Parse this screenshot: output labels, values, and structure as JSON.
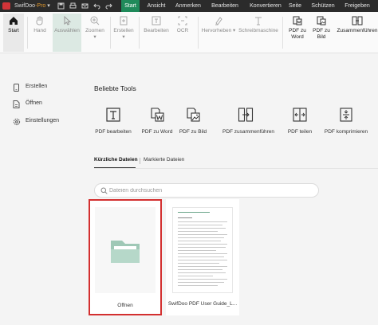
{
  "app": {
    "brand_name": "SwifDoo",
    "brand_suffix": "-Pro",
    "brand_arrow": "▾",
    "accent_color": "#1f8a5a",
    "highlight_color": "#d32f2f"
  },
  "menu": {
    "items": [
      "Start",
      "Ansicht",
      "Anmerken",
      "Bearbeiten",
      "Konvertieren",
      "Seite",
      "Schützen",
      "Freigeben"
    ],
    "active": "Start"
  },
  "ribbon": {
    "start": "Start",
    "hand": "Hand",
    "select": "Auswählen",
    "zoom": "Zoomen",
    "create": "Erstellen",
    "edit": "Bearbeiten",
    "ocr": "OCR",
    "highlight": "Hervorheben",
    "typewriter": "Schreibmaschine",
    "pdf_to_word_1": "PDF zu",
    "pdf_to_word_2": "Word",
    "pdf_to_image_1": "PDF zu",
    "pdf_to_image_2": "Bild",
    "merge": "Zusammenführen"
  },
  "sidebar": {
    "items": [
      {
        "label": "Erstellen",
        "icon": "phone-icon"
      },
      {
        "label": "Öffnen",
        "icon": "file-icon"
      },
      {
        "label": "Einstellungen",
        "icon": "gear-icon"
      }
    ]
  },
  "main": {
    "popular_title": "Beliebte Tools",
    "tools": [
      {
        "label": "PDF bearbeiten",
        "icon": "edit-text-icon"
      },
      {
        "label": "PDF zu Word",
        "icon": "pdf-to-word-icon"
      },
      {
        "label": "PDF zu Bild",
        "icon": "pdf-to-image-icon"
      },
      {
        "label": "PDF zusammenführen",
        "icon": "merge-icon"
      },
      {
        "label": "PDF teilen",
        "icon": "split-icon"
      },
      {
        "label": "PDF komprimieren",
        "icon": "compress-icon"
      }
    ],
    "tabs": {
      "recent": "Kürzliche Dateien",
      "starred": "Markierte Dateien"
    },
    "search_placeholder": "Dateien durchsuchen",
    "cards": [
      {
        "label": "Öffnen",
        "icon": "folder-icon"
      },
      {
        "label": "SwifDoo PDF User Guide_L..."
      }
    ]
  }
}
